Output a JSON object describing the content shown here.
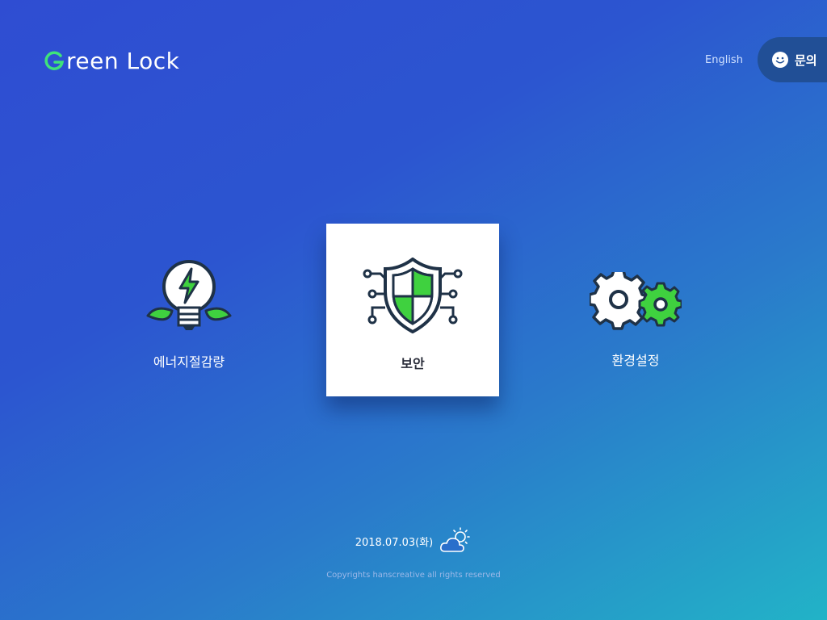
{
  "header": {
    "logo_text": "reen Lock",
    "lang_link": "English",
    "contact_button": "문의"
  },
  "menu": [
    {
      "label": "에너지절감량",
      "icon": "lightbulb-leaves-icon"
    },
    {
      "label": "보안",
      "icon": "security-shield-icon"
    },
    {
      "label": "환경설정",
      "icon": "gears-icon"
    }
  ],
  "footer": {
    "date": "2018.07.03(화)",
    "weather_icon": "partly-cloudy-icon",
    "copyright": "Copyrights hanscreative all rights reserved"
  },
  "colors": {
    "accent_green": "#3fd13f",
    "dark_stroke": "#1f3247",
    "contact_bg": "#214f96"
  }
}
